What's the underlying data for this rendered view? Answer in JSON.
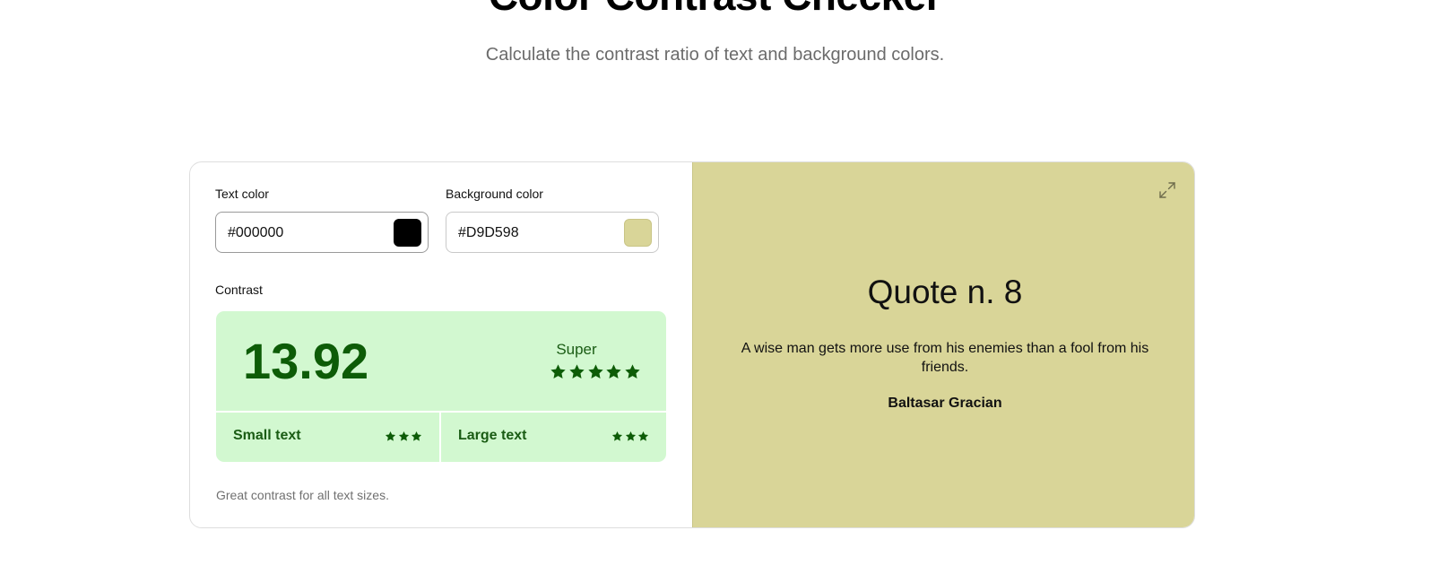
{
  "header": {
    "title": "Color Contrast Checker",
    "subtitle": "Calculate the contrast ratio of text and background colors."
  },
  "inputs": {
    "text_color": {
      "label": "Text color",
      "value": "#000000",
      "swatch": "#000000"
    },
    "background_color": {
      "label": "Background color",
      "value": "#D9D598",
      "swatch": "#D9D598"
    }
  },
  "contrast": {
    "label": "Contrast",
    "ratio": "13.92",
    "rating": "Super",
    "rating_stars": 5,
    "small_text": {
      "label": "Small text",
      "stars": 3
    },
    "large_text": {
      "label": "Large text",
      "stars": 3
    },
    "note": "Great contrast for all text sizes.",
    "accent_color": "#0d5c07",
    "box_color": "#d2f8d0"
  },
  "preview": {
    "title": "Quote n. 8",
    "quote": "A wise man gets more use from his enemies than a fool from his friends.",
    "author": "Baltasar Gracian",
    "background": "#D9D598",
    "expand_icon": "expand-icon"
  }
}
